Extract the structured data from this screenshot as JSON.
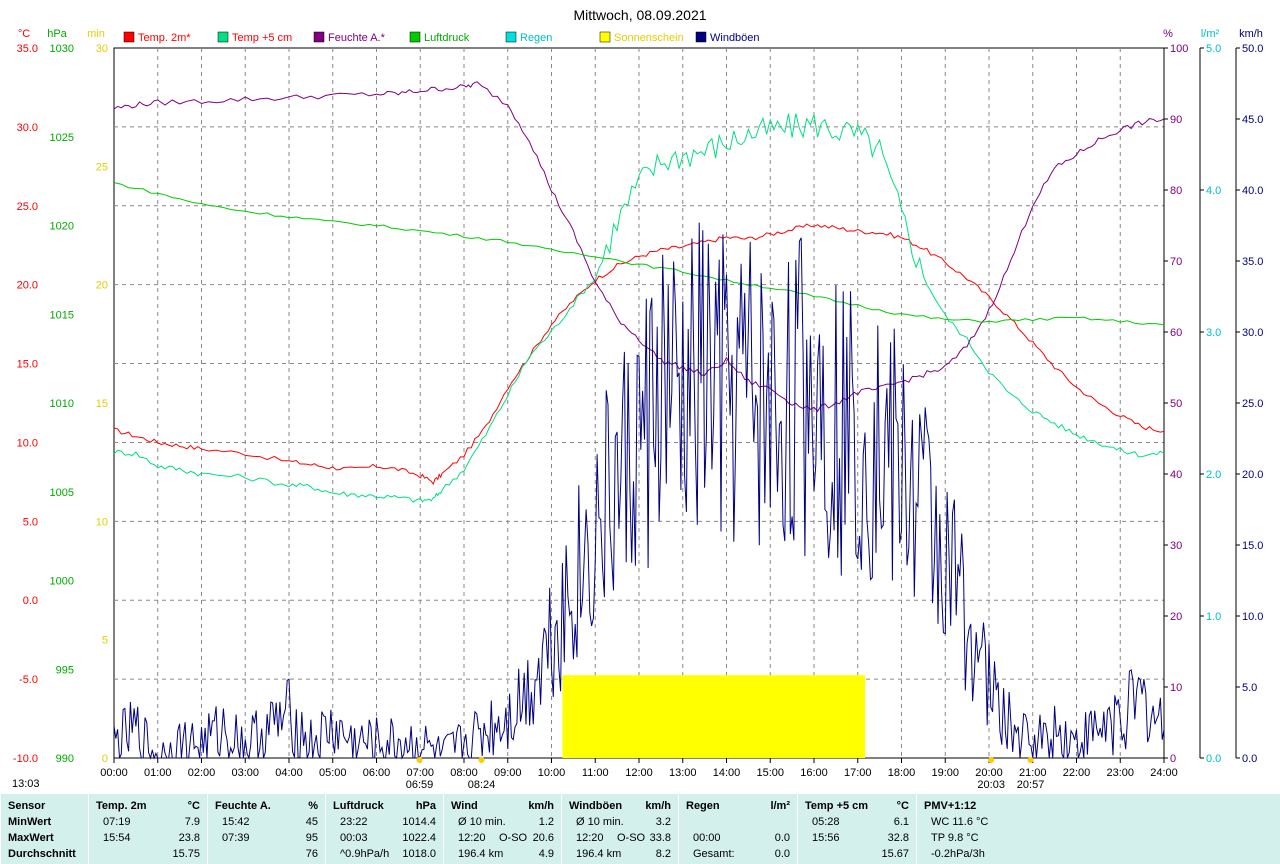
{
  "title": "Mittwoch, 08.09.2021",
  "left_units": {
    "temp": "°C",
    "pressure": "hPa",
    "sunshine": "min"
  },
  "right_units": {
    "humidity": "%",
    "rain": "l/m²",
    "wind": "km/h"
  },
  "legend": [
    {
      "label": "Temp. 2m*",
      "color": "#ff0000",
      "text_color": "#ff0000"
    },
    {
      "label": "Temp +5 cm",
      "color": "#00e080",
      "text_color": "#ff0000"
    },
    {
      "label": "Feuchte A.*",
      "color": "#800080",
      "text_color": "#800080"
    },
    {
      "label": "Luftdruck",
      "color": "#00cc00",
      "text_color": "#00aa00"
    },
    {
      "label": "Regen",
      "color": "#00e0e0",
      "text_color": "#00c0c0"
    },
    {
      "label": "Sonnenschein",
      "color": "#ffff00",
      "text_color": "#e0d000"
    },
    {
      "label": "Windböen",
      "color": "#000080",
      "text_color": "#000080"
    }
  ],
  "chart_data": {
    "type": "line",
    "x_ticks": [
      "00:00",
      "01:00",
      "02:00",
      "03:00",
      "04:00",
      "05:00",
      "06:00",
      "07:00",
      "08:00",
      "09:00",
      "10:00",
      "11:00",
      "12:00",
      "13:00",
      "14:00",
      "15:00",
      "16:00",
      "17:00",
      "18:00",
      "19:00",
      "20:00",
      "21:00",
      "22:00",
      "23:00",
      "24:00"
    ],
    "axes": {
      "temp": {
        "ticks": [
          "35.0",
          "30.0",
          "25.0",
          "20.0",
          "15.0",
          "10.0",
          "5.0",
          "0.0",
          "-5.0",
          "-10.0"
        ],
        "ylim": [
          -10,
          35
        ]
      },
      "pressure": {
        "ticks": [
          "1030",
          "1025",
          "1020",
          "1015",
          "1010",
          "1005",
          "1000",
          "995",
          "990"
        ],
        "ylim": [
          990,
          1030
        ]
      },
      "sunshine": {
        "ticks": [
          "30",
          "25",
          "20",
          "15",
          "10",
          "5",
          "0"
        ],
        "ylim": [
          0,
          30
        ]
      },
      "humidity": {
        "ticks": [
          "100",
          "90",
          "80",
          "70",
          "60",
          "50",
          "40",
          "30",
          "20",
          "10",
          "0"
        ],
        "ylim": [
          0,
          100
        ]
      },
      "rain": {
        "ticks": [
          "5.0",
          "4.0",
          "3.0",
          "2.0",
          "1.0",
          "0.0"
        ],
        "ylim": [
          0,
          5
        ]
      },
      "wind": {
        "ticks": [
          "50.0",
          "45.0",
          "40.0",
          "35.0",
          "30.0",
          "25.0",
          "20.0",
          "15.0",
          "10.0",
          "5.0",
          "0.0"
        ],
        "ylim": [
          0,
          50
        ]
      }
    },
    "grid": true,
    "series": [
      {
        "name": "Temp. 2m*",
        "axis": "temp",
        "color": "#ff0000",
        "x": [
          0,
          0.5,
          1,
          1.5,
          2,
          3,
          4,
          4.5,
          5,
          5.5,
          6,
          6.5,
          7,
          7.3,
          7.5,
          8,
          8.5,
          9,
          9.5,
          10,
          10.5,
          11,
          11.5,
          12,
          12.5,
          13,
          13.5,
          14,
          14.5,
          15,
          15.5,
          16,
          16.5,
          17,
          17.5,
          18,
          18.5,
          19,
          19.5,
          20,
          20.5,
          21,
          21.5,
          22,
          22.5,
          23,
          23.5,
          24
        ],
        "y": [
          10.8,
          10.4,
          10.0,
          9.8,
          9.6,
          9.3,
          8.8,
          8.6,
          8.4,
          8.3,
          8.5,
          8.3,
          7.9,
          7.5,
          8.0,
          9.2,
          11.0,
          13.5,
          15.5,
          17.5,
          19.0,
          20.3,
          21.2,
          21.8,
          22.2,
          22.4,
          22.7,
          23.0,
          22.9,
          23.2,
          23.5,
          23.8,
          23.6,
          23.4,
          23.3,
          23.0,
          22.3,
          21.4,
          20.4,
          19.2,
          17.8,
          16.3,
          14.8,
          13.5,
          12.5,
          11.7,
          11.0,
          10.7
        ]
      },
      {
        "name": "Temp +5 cm",
        "axis": "temp",
        "color": "#00e080",
        "x": [
          0,
          0.5,
          1,
          1.5,
          2,
          3,
          4,
          4.5,
          5,
          5.5,
          6,
          6.5,
          7,
          7.3,
          7.5,
          8,
          8.5,
          9,
          9.5,
          10,
          10.5,
          11,
          11.5,
          12,
          12.5,
          13,
          13.5,
          14,
          14.5,
          15,
          15.5,
          16,
          16.5,
          17,
          17.5,
          18,
          18.5,
          19,
          19.5,
          20,
          20.5,
          21,
          21.5,
          22,
          22.5,
          23,
          23.5,
          24
        ],
        "y": [
          9.4,
          9.3,
          8.5,
          8.3,
          8.0,
          7.8,
          7.3,
          7.2,
          6.8,
          6.7,
          6.6,
          6.5,
          6.3,
          6.4,
          7.0,
          8.3,
          10.5,
          13.0,
          15.5,
          17.0,
          18.8,
          20.5,
          24.0,
          26.5,
          27.8,
          28.2,
          28.5,
          29.0,
          29.5,
          29.8,
          30.0,
          30.2,
          29.8,
          29.5,
          28.5,
          24.5,
          20.5,
          18.0,
          16.5,
          14.5,
          13.0,
          12.0,
          11.2,
          10.5,
          10.0,
          9.5,
          9.2,
          9.3
        ]
      },
      {
        "name": "Feuchte A.*",
        "axis": "humidity",
        "color": "#800080",
        "x": [
          0,
          0.5,
          1,
          2,
          3,
          4,
          5,
          6,
          6.5,
          7,
          7.5,
          8,
          8.3,
          9,
          9.5,
          10,
          10.5,
          11,
          11.5,
          12,
          12.5,
          13,
          13.5,
          14,
          14.5,
          15,
          15.5,
          16,
          16.5,
          17,
          17.5,
          18,
          18.5,
          19,
          19.5,
          20,
          20.5,
          21,
          21.5,
          22,
          22.5,
          23,
          23.5,
          24
        ],
        "y": [
          91.5,
          92,
          92.3,
          92.5,
          92.8,
          93,
          93.3,
          93.5,
          93.6,
          94,
          94.3,
          94.5,
          95,
          92,
          87,
          80,
          74,
          67,
          62,
          59,
          56,
          55,
          54,
          56,
          53,
          52,
          50,
          49,
          50,
          51.5,
          52,
          53,
          54,
          55,
          58,
          63,
          70,
          78,
          83,
          85,
          87,
          88.5,
          89.5,
          90
        ]
      },
      {
        "name": "Luftdruck",
        "axis": "pressure",
        "color": "#00cc00",
        "x": [
          0,
          1,
          2,
          3,
          4,
          5,
          6,
          7,
          8,
          9,
          10,
          11,
          12,
          13,
          14,
          15,
          16,
          17,
          18,
          19,
          20,
          21,
          22,
          23,
          24
        ],
        "y": [
          1022.4,
          1021.8,
          1021.2,
          1020.8,
          1020.5,
          1020.2,
          1020.0,
          1019.7,
          1019.4,
          1019.1,
          1018.6,
          1018.3,
          1017.8,
          1017.4,
          1016.9,
          1016.5,
          1016.0,
          1015.5,
          1015.0,
          1014.7,
          1014.6,
          1014.7,
          1014.8,
          1014.6,
          1014.4
        ]
      },
      {
        "name": "Windböen",
        "axis": "wind",
        "color": "#000080",
        "x": [
          0,
          0.5,
          1,
          1.5,
          2,
          2.5,
          3,
          3.5,
          4,
          4.5,
          5,
          5.5,
          6,
          6.5,
          7,
          7.5,
          8,
          8.5,
          9,
          9.5,
          10,
          10.5,
          11,
          11.5,
          12,
          12.5,
          13,
          13.5,
          14,
          14.5,
          15,
          15.5,
          16,
          16.5,
          17,
          17.5,
          18,
          18.5,
          19,
          19.5,
          20,
          20.5,
          21,
          21.5,
          22,
          22.5,
          23,
          23.5,
          24
        ],
        "y": [
          1,
          2,
          0,
          1,
          1,
          2,
          1,
          2,
          3,
          1,
          2,
          1,
          1,
          1,
          1,
          0,
          1,
          2,
          3,
          5,
          9,
          12,
          16,
          19,
          22,
          26,
          24,
          27,
          25,
          26,
          24,
          25,
          27,
          24,
          23,
          22,
          20,
          18,
          14,
          10,
          5,
          2,
          1,
          2,
          1,
          2,
          3,
          4,
          2
        ]
      }
    ],
    "sunshine_block": {
      "start": "10:15",
      "end": "17:10",
      "value_min": 3.5
    },
    "x_markers": [
      {
        "label": "06:59",
        "time": "06:59"
      },
      {
        "label": "08:24",
        "time": "08:24"
      },
      {
        "label": "20:03",
        "time": "20:03"
      },
      {
        "label": "20:57",
        "time": "20:57"
      }
    ],
    "left_corner_label": "13:03"
  },
  "stats": {
    "rows": [
      "MinWert",
      "MaxWert",
      "Durchschnitt"
    ],
    "columns": [
      {
        "title": "Sensor",
        "unit": "",
        "cells": [
          [
            "MinWert",
            "",
            ""
          ],
          [
            "MaxWert",
            "",
            ""
          ],
          [
            "Durchschnitt",
            "",
            ""
          ]
        ]
      },
      {
        "title": "Temp. 2m",
        "unit": "°C",
        "cells": [
          [
            "07:19",
            "",
            "7.9"
          ],
          [
            "15:54",
            "",
            "23.8"
          ],
          [
            "",
            "",
            "15.75"
          ]
        ]
      },
      {
        "title": "Feuchte A.",
        "unit": "%",
        "cells": [
          [
            "15:42",
            "",
            "45"
          ],
          [
            "07:39",
            "",
            "95"
          ],
          [
            "",
            "",
            "76"
          ]
        ]
      },
      {
        "title": "Luftdruck",
        "unit": "hPa",
        "cells": [
          [
            "23:22",
            "",
            "1014.4"
          ],
          [
            "00:03",
            "",
            "1022.4"
          ],
          [
            "^0.9hPa/h",
            "",
            "1018.0"
          ]
        ]
      },
      {
        "title": "Wind",
        "unit": "km/h",
        "cells": [
          [
            "Ø 10 min.",
            "",
            "1.2"
          ],
          [
            "12:20",
            "O-SO",
            "20.6"
          ],
          [
            "196.4 km",
            "",
            "4.9"
          ]
        ]
      },
      {
        "title": "Windböen",
        "unit": "km/h",
        "cells": [
          [
            "Ø 10 min.",
            "",
            "3.2"
          ],
          [
            "12:20",
            "O-SO",
            "33.8"
          ],
          [
            "196.4 km",
            "",
            "8.2"
          ]
        ]
      },
      {
        "title": "Regen",
        "unit": "l/m²",
        "cells": [
          [
            "",
            "",
            ""
          ],
          [
            "00:00",
            "",
            "0.0"
          ],
          [
            "Gesamt:",
            "",
            "0.0"
          ]
        ]
      },
      {
        "title": "Temp +5 cm",
        "unit": "°C",
        "cells": [
          [
            "05:28",
            "",
            "6.1"
          ],
          [
            "15:56",
            "",
            "32.8"
          ],
          [
            "",
            "",
            "15.67"
          ]
        ]
      },
      {
        "title": "PMV+1:12",
        "unit": "",
        "cells": [
          [
            "WC 11.6 °C",
            "",
            ""
          ],
          [
            "TP 9.8 °C",
            "",
            ""
          ],
          [
            "-0.2hPa/3h",
            "",
            ""
          ]
        ]
      }
    ]
  }
}
